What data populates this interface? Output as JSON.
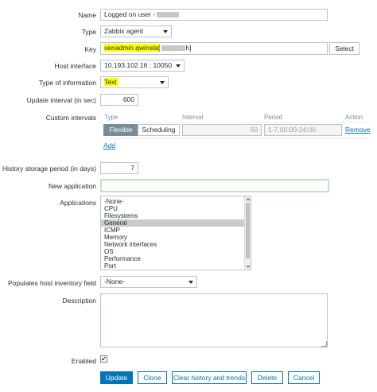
{
  "form": {
    "name": {
      "label": "Name",
      "value": "Logged on user -"
    },
    "type": {
      "label": "Type",
      "value": "Zabbix agent"
    },
    "key": {
      "label": "Key",
      "value": "xenadmin.qwinsta[",
      "value_suffix": "h]",
      "select_label": "Select"
    },
    "host_interface": {
      "label": "Host interface",
      "value": "10.193.102.16 : 10050"
    },
    "type_of_information": {
      "label": "Type of information",
      "value": "Text"
    },
    "update_interval": {
      "label": "Update interval (in sec)",
      "value": "600"
    },
    "custom_intervals": {
      "label": "Custom intervals",
      "headers": {
        "type": "Type",
        "interval": "Interval",
        "period": "Period",
        "action": "Action"
      },
      "row": {
        "flexible": "Flexible",
        "scheduling": "Scheduling",
        "interval": "50",
        "period": "1-7,00:00-24:00",
        "remove": "Remove"
      },
      "add": "Add"
    },
    "history": {
      "label": "History storage period (in days)",
      "value": "7"
    },
    "new_application": {
      "label": "New application",
      "value": ""
    },
    "applications": {
      "label": "Applications",
      "options": [
        "-None-",
        "CPU",
        "Filesystems",
        "General",
        "ICMP",
        "Memory",
        "Network interfaces",
        "OS",
        "Performance",
        "Port"
      ],
      "selected": "General"
    },
    "inventory": {
      "label": "Populates host inventory field",
      "value": "-None-"
    },
    "description": {
      "label": "Description",
      "value": ""
    },
    "enabled": {
      "label": "Enabled",
      "check": "✔"
    }
  },
  "buttons": {
    "update": "Update",
    "clone": "Clone",
    "clear": "Clear history and trends",
    "delete": "Delete",
    "cancel": "Cancel"
  },
  "colors": {
    "accent": "#0275b8",
    "highlight": "#ffff00",
    "focus_border": "#c2e0c2"
  }
}
